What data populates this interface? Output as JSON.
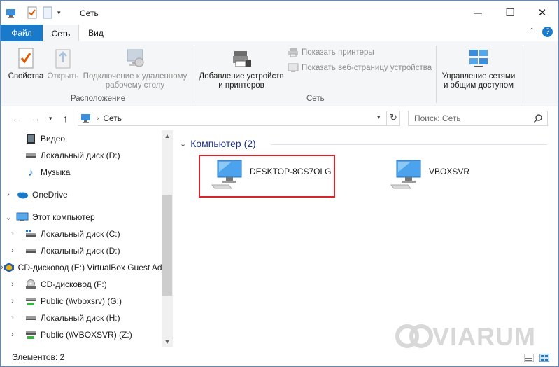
{
  "window": {
    "title": "Сеть",
    "controls": {
      "minimize": "—",
      "maximize": "☐",
      "close": "✕"
    }
  },
  "tabs": [
    {
      "label": "Файл"
    },
    {
      "label": "Сеть"
    },
    {
      "label": "Вид"
    }
  ],
  "ribbon": {
    "groups": [
      {
        "label": "Расположение"
      },
      {
        "label": "Сеть"
      }
    ],
    "buttons": {
      "properties": "Свойства",
      "open": "Открыть",
      "connect_line1": "Подключение к удаленному",
      "connect_line2": "рабочему столу",
      "add_devices_line1": "Добавление устройств",
      "add_devices_line2": "и принтеров",
      "show_printers": "Показать принтеры",
      "show_device_page": "Показать веб-страницу устройства",
      "network_center_line1": "Управление сетями",
      "network_center_line2": "и общим доступом"
    }
  },
  "address": {
    "path": "Сеть",
    "search_placeholder": "Поиск: Сеть"
  },
  "nav": {
    "items": [
      {
        "label": "Видео"
      },
      {
        "label": "Локальный диск (D:)"
      },
      {
        "label": "Музыка"
      },
      {
        "label": "OneDrive"
      },
      {
        "label": "Этот компьютер"
      },
      {
        "label": "Локальный диск (C:)"
      },
      {
        "label": "Локальный диск (D:)"
      },
      {
        "label": "CD-дисковод (E:) VirtualBox Guest Additions"
      },
      {
        "label": "CD-дисковод (F:)"
      },
      {
        "label": "Public (\\\\vboxsrv) (G:)"
      },
      {
        "label": "Локальный диск (H:)"
      },
      {
        "label": "Public (\\\\VBOXSVR) (Z:)"
      }
    ]
  },
  "content": {
    "group_header": "Компьютер (2)",
    "computers": [
      {
        "name": "DESKTOP-8CS7OLG"
      },
      {
        "name": "VBOXSVR"
      }
    ]
  },
  "watermark": "VIARUM",
  "status": {
    "items_count": "Элементов: 2"
  },
  "colors": {
    "accent": "#1979ca",
    "selection_border": "#d9232a",
    "group_header": "#1e3287"
  }
}
